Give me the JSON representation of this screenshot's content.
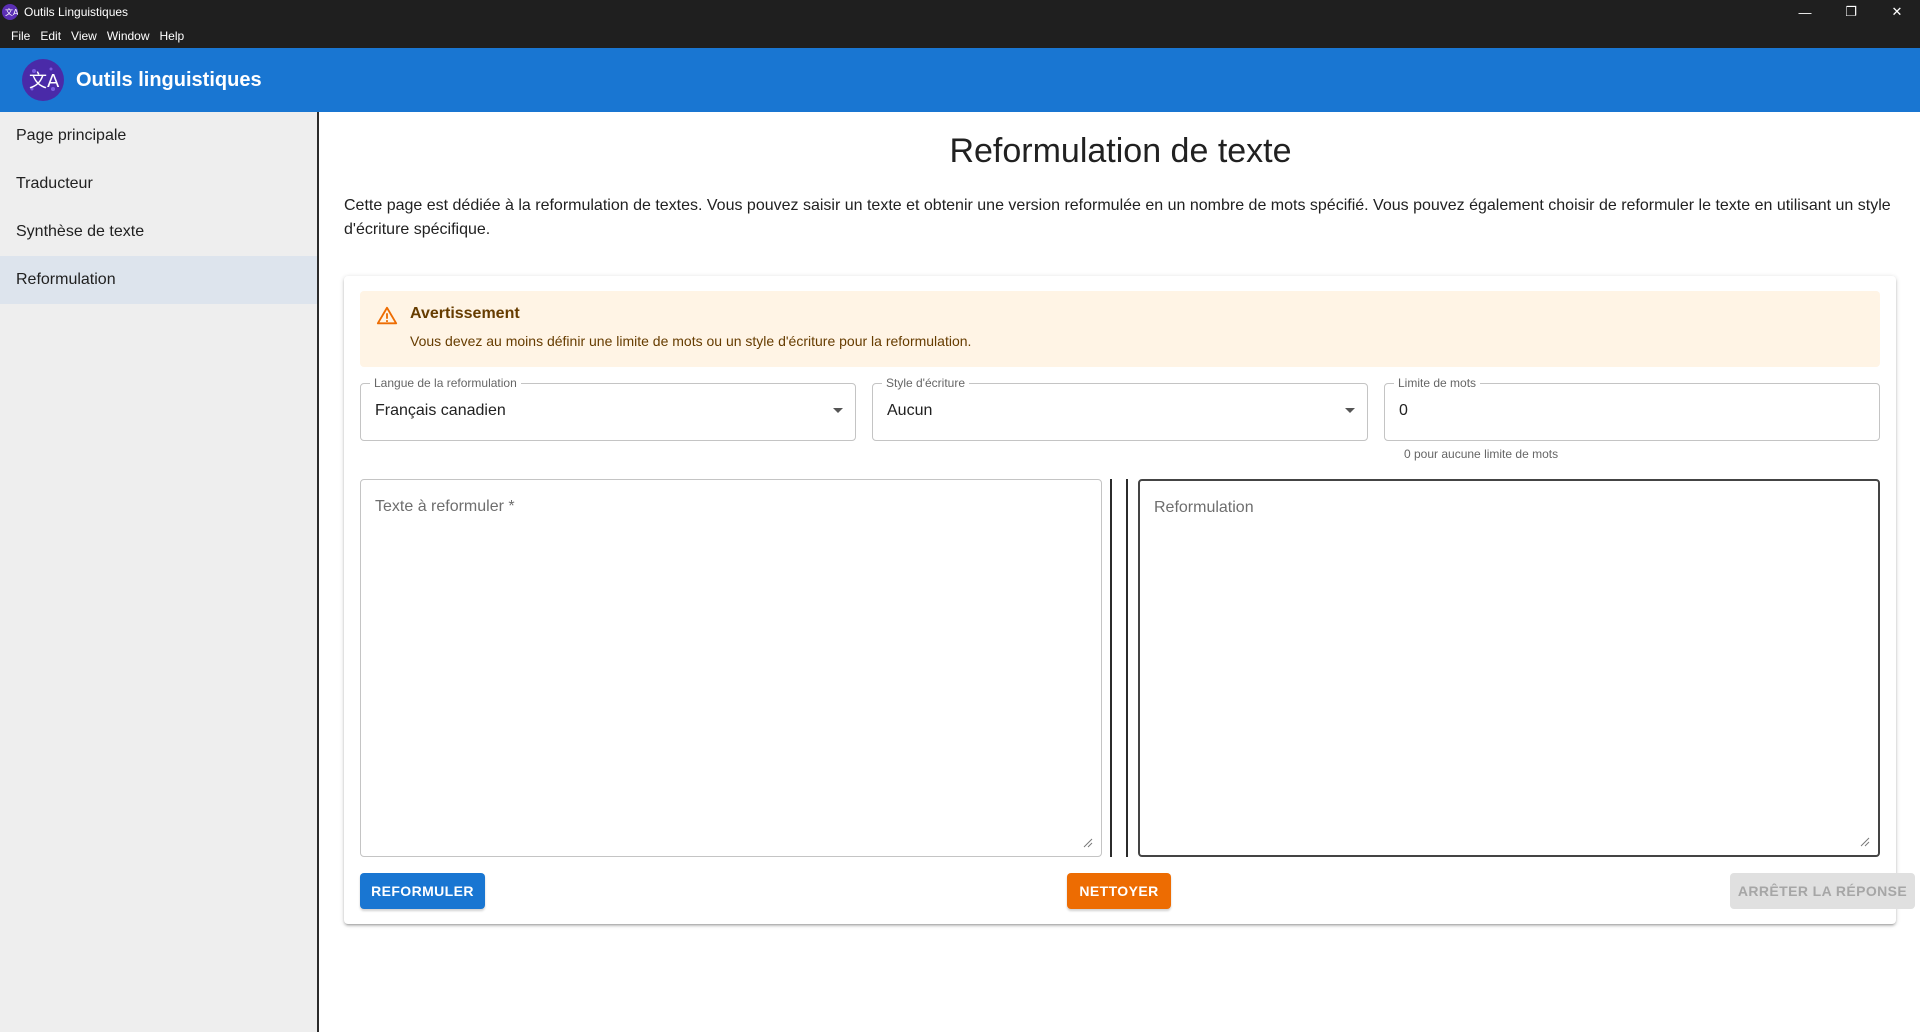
{
  "window": {
    "title": "Outils Linguistiques",
    "controls": {
      "minimize": "—",
      "restore": "❐",
      "close": "✕"
    }
  },
  "menu": {
    "items": [
      "File",
      "Edit",
      "View",
      "Window",
      "Help"
    ]
  },
  "header": {
    "app_name": "Outils linguistiques",
    "brand_color": "#1976d2"
  },
  "sidebar": {
    "items": [
      {
        "label": "Page principale",
        "active": false
      },
      {
        "label": "Traducteur",
        "active": false
      },
      {
        "label": "Synthèse de texte",
        "active": false
      },
      {
        "label": "Reformulation",
        "active": true
      }
    ]
  },
  "main": {
    "title": "Reformulation de texte",
    "description": "Cette page est dédiée à la reformulation de textes. Vous pouvez saisir un texte et obtenir une version reformulée en un nombre de mots spécifié. Vous pouvez également choisir de reformuler le texte en utilisant un style d'écriture spécifique.",
    "alert": {
      "title": "Avertissement",
      "message": "Vous devez au moins définir une limite de mots ou un style d'écriture pour la reformulation.",
      "icon": "warning-icon",
      "color": "#ed6c02"
    },
    "fields": {
      "language": {
        "label": "Langue de la reformulation",
        "value": "Français canadien"
      },
      "style": {
        "label": "Style d'écriture",
        "value": "Aucun"
      },
      "word_limit": {
        "label": "Limite de mots",
        "value": "0",
        "helper": "0 pour aucune limite de mots"
      }
    },
    "input_text": {
      "placeholder": "Texte à reformuler *"
    },
    "output_text": {
      "placeholder": "Reformulation"
    },
    "buttons": {
      "reformulate": "REFORMULER",
      "clear": "NETTOYER",
      "stop": "ARRÊTER LA RÉPONSE"
    }
  }
}
